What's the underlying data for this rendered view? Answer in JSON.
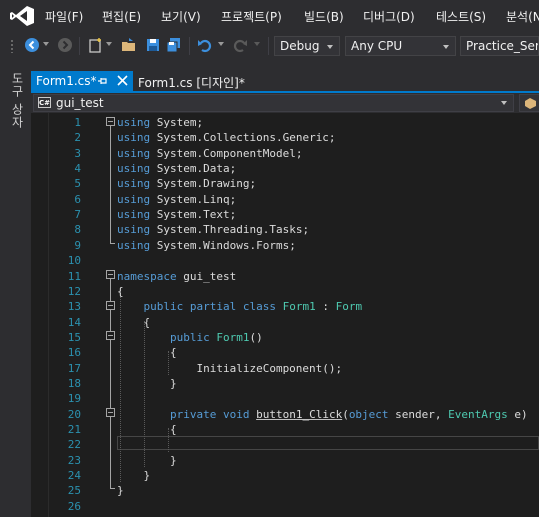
{
  "menu": {
    "items": [
      "파일(F)",
      "편집(E)",
      "보기(V)",
      "프로젝트(P)",
      "빌드(B)",
      "디버그(D)",
      "테스트(S)",
      "분석(N"
    ]
  },
  "toolbar": {
    "config": "Debug",
    "platform": "Any CPU",
    "project": "Practice_Serial"
  },
  "side_panel": {
    "label": "도구 상자"
  },
  "tabs": [
    {
      "label": "Form1.cs*",
      "active": true
    },
    {
      "label": "Form1.cs [디자인]*",
      "active": false
    }
  ],
  "navbar": {
    "badge": "C#",
    "scope": "gui_test"
  },
  "editor": {
    "lines": [
      {
        "no": "1",
        "tokens": [
          [
            "kw",
            "using"
          ],
          [
            "tx",
            " System;"
          ]
        ]
      },
      {
        "no": "2",
        "tokens": [
          [
            "kw",
            "using"
          ],
          [
            "tx",
            " System.Collections.Generic;"
          ]
        ]
      },
      {
        "no": "3",
        "tokens": [
          [
            "kw",
            "using"
          ],
          [
            "tx",
            " System.ComponentModel;"
          ]
        ]
      },
      {
        "no": "4",
        "tokens": [
          [
            "kw",
            "using"
          ],
          [
            "tx",
            " System.Data;"
          ]
        ]
      },
      {
        "no": "5",
        "tokens": [
          [
            "kw",
            "using"
          ],
          [
            "tx",
            " System.Drawing;"
          ]
        ]
      },
      {
        "no": "6",
        "tokens": [
          [
            "kw",
            "using"
          ],
          [
            "tx",
            " System.Linq;"
          ]
        ]
      },
      {
        "no": "7",
        "tokens": [
          [
            "kw",
            "using"
          ],
          [
            "tx",
            " System.Text;"
          ]
        ]
      },
      {
        "no": "8",
        "tokens": [
          [
            "kw",
            "using"
          ],
          [
            "tx",
            " System.Threading.Tasks;"
          ]
        ]
      },
      {
        "no": "9",
        "tokens": [
          [
            "kw",
            "using"
          ],
          [
            "tx",
            " System.Windows.Forms;"
          ]
        ]
      },
      {
        "no": "10",
        "tokens": []
      },
      {
        "no": "11",
        "tokens": [
          [
            "kw",
            "namespace"
          ],
          [
            "tx",
            " gui_test"
          ]
        ]
      },
      {
        "no": "12",
        "tokens": [
          [
            "tx",
            "{"
          ]
        ]
      },
      {
        "no": "13",
        "tokens": [
          [
            "tx",
            "    "
          ],
          [
            "kw",
            "public partial class"
          ],
          [
            "tx",
            " "
          ],
          [
            "ty",
            "Form1"
          ],
          [
            "tx",
            " : "
          ],
          [
            "ty",
            "Form"
          ]
        ]
      },
      {
        "no": "14",
        "tokens": [
          [
            "tx",
            "    {"
          ]
        ]
      },
      {
        "no": "15",
        "tokens": [
          [
            "tx",
            "        "
          ],
          [
            "kw",
            "public"
          ],
          [
            "tx",
            " "
          ],
          [
            "ty",
            "Form1"
          ],
          [
            "tx",
            "()"
          ]
        ]
      },
      {
        "no": "16",
        "tokens": [
          [
            "tx",
            "        {"
          ]
        ]
      },
      {
        "no": "17",
        "tokens": [
          [
            "tx",
            "            InitializeComponent();"
          ]
        ]
      },
      {
        "no": "18",
        "tokens": [
          [
            "tx",
            "        }"
          ]
        ]
      },
      {
        "no": "19",
        "tokens": []
      },
      {
        "no": "20",
        "tokens": [
          [
            "tx",
            "        "
          ],
          [
            "kw",
            "private void"
          ],
          [
            "tx",
            " "
          ],
          [
            "sq",
            "button1_Click"
          ],
          [
            "tx",
            "("
          ],
          [
            "kw",
            "object"
          ],
          [
            "tx",
            " sender, "
          ],
          [
            "ty",
            "EventArgs"
          ],
          [
            "tx",
            " e)"
          ]
        ]
      },
      {
        "no": "21",
        "tokens": [
          [
            "tx",
            "        {"
          ]
        ]
      },
      {
        "no": "22",
        "tokens": []
      },
      {
        "no": "23",
        "tokens": [
          [
            "tx",
            "        }"
          ]
        ]
      },
      {
        "no": "24",
        "tokens": [
          [
            "tx",
            "    }"
          ]
        ]
      },
      {
        "no": "25",
        "tokens": [
          [
            "tx",
            "}"
          ]
        ]
      },
      {
        "no": "26",
        "tokens": []
      }
    ]
  },
  "colors": {
    "accent": "#007acc",
    "keyword": "#569cd6",
    "type": "#4ec9b0",
    "line_number": "#2b91af"
  }
}
